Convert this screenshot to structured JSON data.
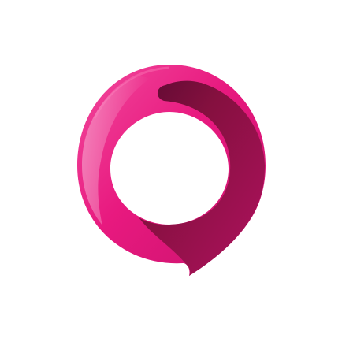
{
  "image": {
    "background_color": "#ffffff"
  },
  "logo": {
    "icon": "pink-ring-speech-bubble-logo",
    "colors": {
      "primary": "#e8197f",
      "highlight": "#f35aa5",
      "shadow": "#9e1355",
      "deep": "#5e0a32"
    }
  }
}
